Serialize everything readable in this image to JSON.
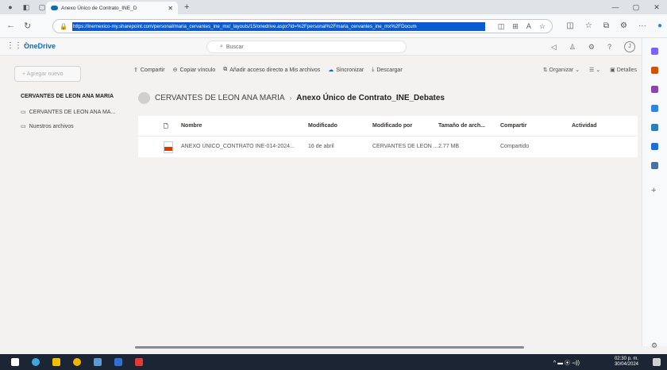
{
  "browser": {
    "tab_title": "Anexo Único de Contrato_INE_D",
    "url": "https://inemexico-my.sharepoint.com/personal/maria_cervantes_ine_mx/_layouts/15/onedrive.aspx?id=%2Fpersonal%2Fmaria_cervantes_ine_mx%2FDocum"
  },
  "app": {
    "name": "OneDrive",
    "search_placeholder": "Buscar",
    "avatar": "J"
  },
  "sidebar": {
    "new_label": "+  Agregar nuevo",
    "owner": "CERVANTES DE LEON ANA MARIA",
    "items": [
      {
        "label": "CERVANTES DE LEON ANA MA..."
      },
      {
        "label": "Nuestros archivos"
      }
    ]
  },
  "commands": {
    "share": "Compartir",
    "copy_link": "Copiar vínculo",
    "add_shortcut": "Añadir acceso directo a Mis archivos",
    "sync": "Sincronizar",
    "download": "Descargar",
    "organize": "Organizar",
    "view": "",
    "details": "Detalles"
  },
  "breadcrumb": {
    "owner": "CERVANTES DE LEON ANA MARIA",
    "folder": "Anexo Único de Contrato_INE_Debates"
  },
  "columns": [
    "Nombre",
    "Modificado",
    "Modificado por",
    "Tamaño de arch...",
    "Compartir",
    "Actividad"
  ],
  "rows": [
    {
      "name": "ANEXO ÚNICO_CONTRATO INE-014-2024...",
      "modified": "16 de abril",
      "modified_by": "CERVANTES DE LEON ...",
      "size": "2.77 MB",
      "sharing": "Compartido"
    }
  ],
  "taskbar": {
    "time": "02:30 p. m.",
    "date": "30/04/2024"
  }
}
